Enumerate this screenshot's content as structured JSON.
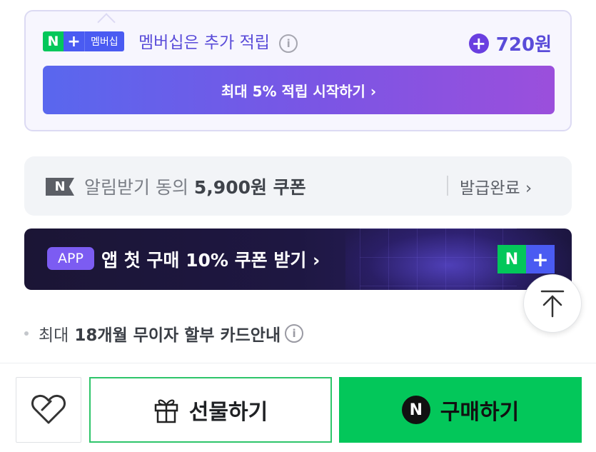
{
  "membership": {
    "badge_n": "N",
    "badge_plus": "+",
    "badge_label": "멤버십",
    "title": "멤버십은 추가 적립",
    "info_glyph": "i",
    "points_plus": "+",
    "points_value": "720원",
    "cta_label": "최대 5% 적립 시작하기 ›"
  },
  "coupon": {
    "icon_letter": "N",
    "prefix": "알림받기 동의",
    "amount": "5,900원 쿠폰",
    "status": "발급완료 ›"
  },
  "app_banner": {
    "pill": "APP",
    "text": "앱 첫 구매 10% 쿠폰 받기 ›",
    "logo_n": "N",
    "logo_plus": "+"
  },
  "installment": {
    "prefix": "최대",
    "highlight": "18개월 무이자 할부 카드안내",
    "info_glyph": "i"
  },
  "bottom_bar": {
    "gift_label": "선물하기",
    "buy_n": "N",
    "buy_label": "구매하기"
  },
  "colors": {
    "accent_green": "#03c75a",
    "membership_purple": "#5a4cd9",
    "banner_dark": "#1b1535"
  }
}
